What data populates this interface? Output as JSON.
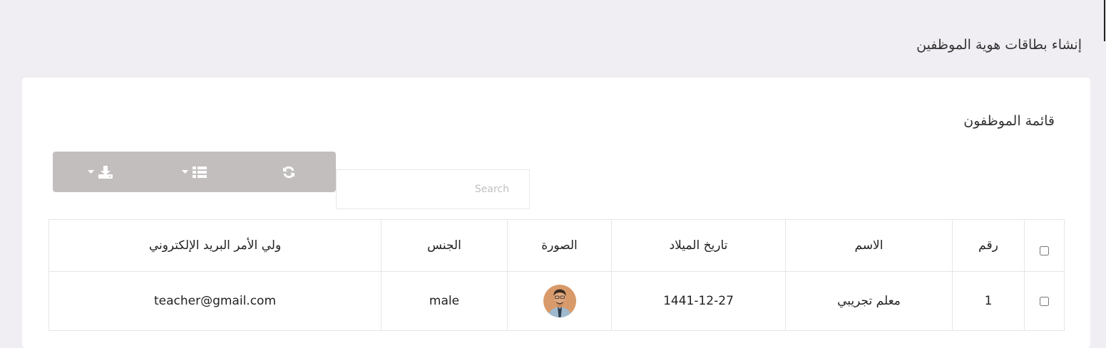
{
  "page": {
    "title": "إنشاء بطاقات هوية الموظفين"
  },
  "card": {
    "title": "قائمة الموظفون"
  },
  "toolbar": {
    "buttons": [
      {
        "icon": "download-icon",
        "has_dropdown": true
      },
      {
        "icon": "columns-icon",
        "has_dropdown": true
      },
      {
        "icon": "refresh-icon",
        "has_dropdown": false
      }
    ],
    "color": "#c3bebe"
  },
  "search": {
    "placeholder": "Search",
    "value": ""
  },
  "table": {
    "columns": [
      "رقم",
      "الاسم",
      "تاريخ الميلاد",
      "الصورة",
      "الجنس",
      "ولي الأمر البريد الإلكتروني"
    ],
    "rows": [
      {
        "number": "1",
        "name": "معلم تجريبي",
        "birth_date": "1441-12-27",
        "photo": "avatar-icon",
        "gender": "male",
        "guardian_email": "teacher@gmail.com"
      }
    ]
  },
  "colors": {
    "background": "#f1eef3",
    "card": "#ffffff",
    "border": "#e6e6e6"
  }
}
